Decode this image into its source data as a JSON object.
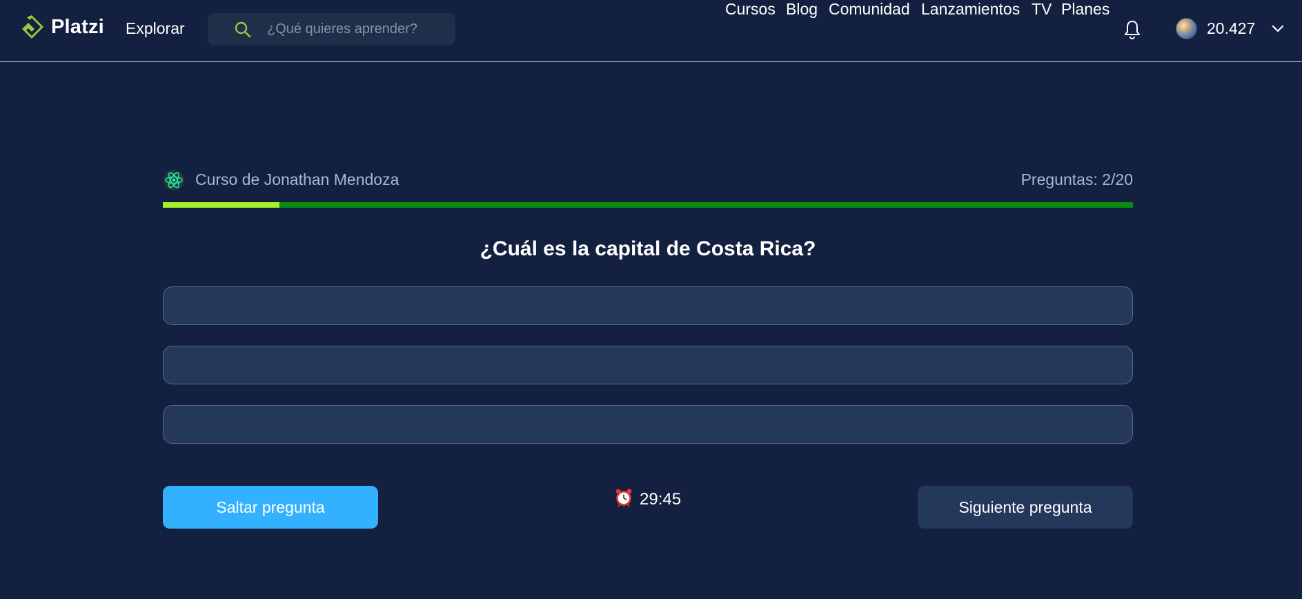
{
  "header": {
    "logo_text": "Platzi",
    "explore_label": "Explorar",
    "search_placeholder": "¿Qué quieres aprender?",
    "nav_links": [
      "Cursos",
      "Blog",
      "Comunidad",
      "Lanzamientos",
      "TV",
      "Planes"
    ],
    "points": "20.427"
  },
  "quiz": {
    "course_name": "Curso de Jonathan Mendoza",
    "question_count": "Preguntas: 2/20",
    "progress_fraction": 0.12,
    "question": "¿Cuál es la capital de Costa Rica?",
    "options": [
      "",
      "",
      ""
    ],
    "skip_label": "Saltar pregunta",
    "next_label": "Siguiente pregunta",
    "timer": "29:45"
  },
  "colors": {
    "background": "#13203f",
    "accent_green": "#98ca3f",
    "progress_done": "#a6f22a",
    "progress_track": "#0b8b0b",
    "skip_button": "#33b1ff",
    "option_bg": "#24385c"
  },
  "icons": {
    "logo": "platzi-logo-icon",
    "search": "search-icon",
    "notifications": "bell-icon",
    "account_menu": "chevron-down-icon",
    "course": "react-atom-icon",
    "timer": "alarm-clock-icon"
  }
}
